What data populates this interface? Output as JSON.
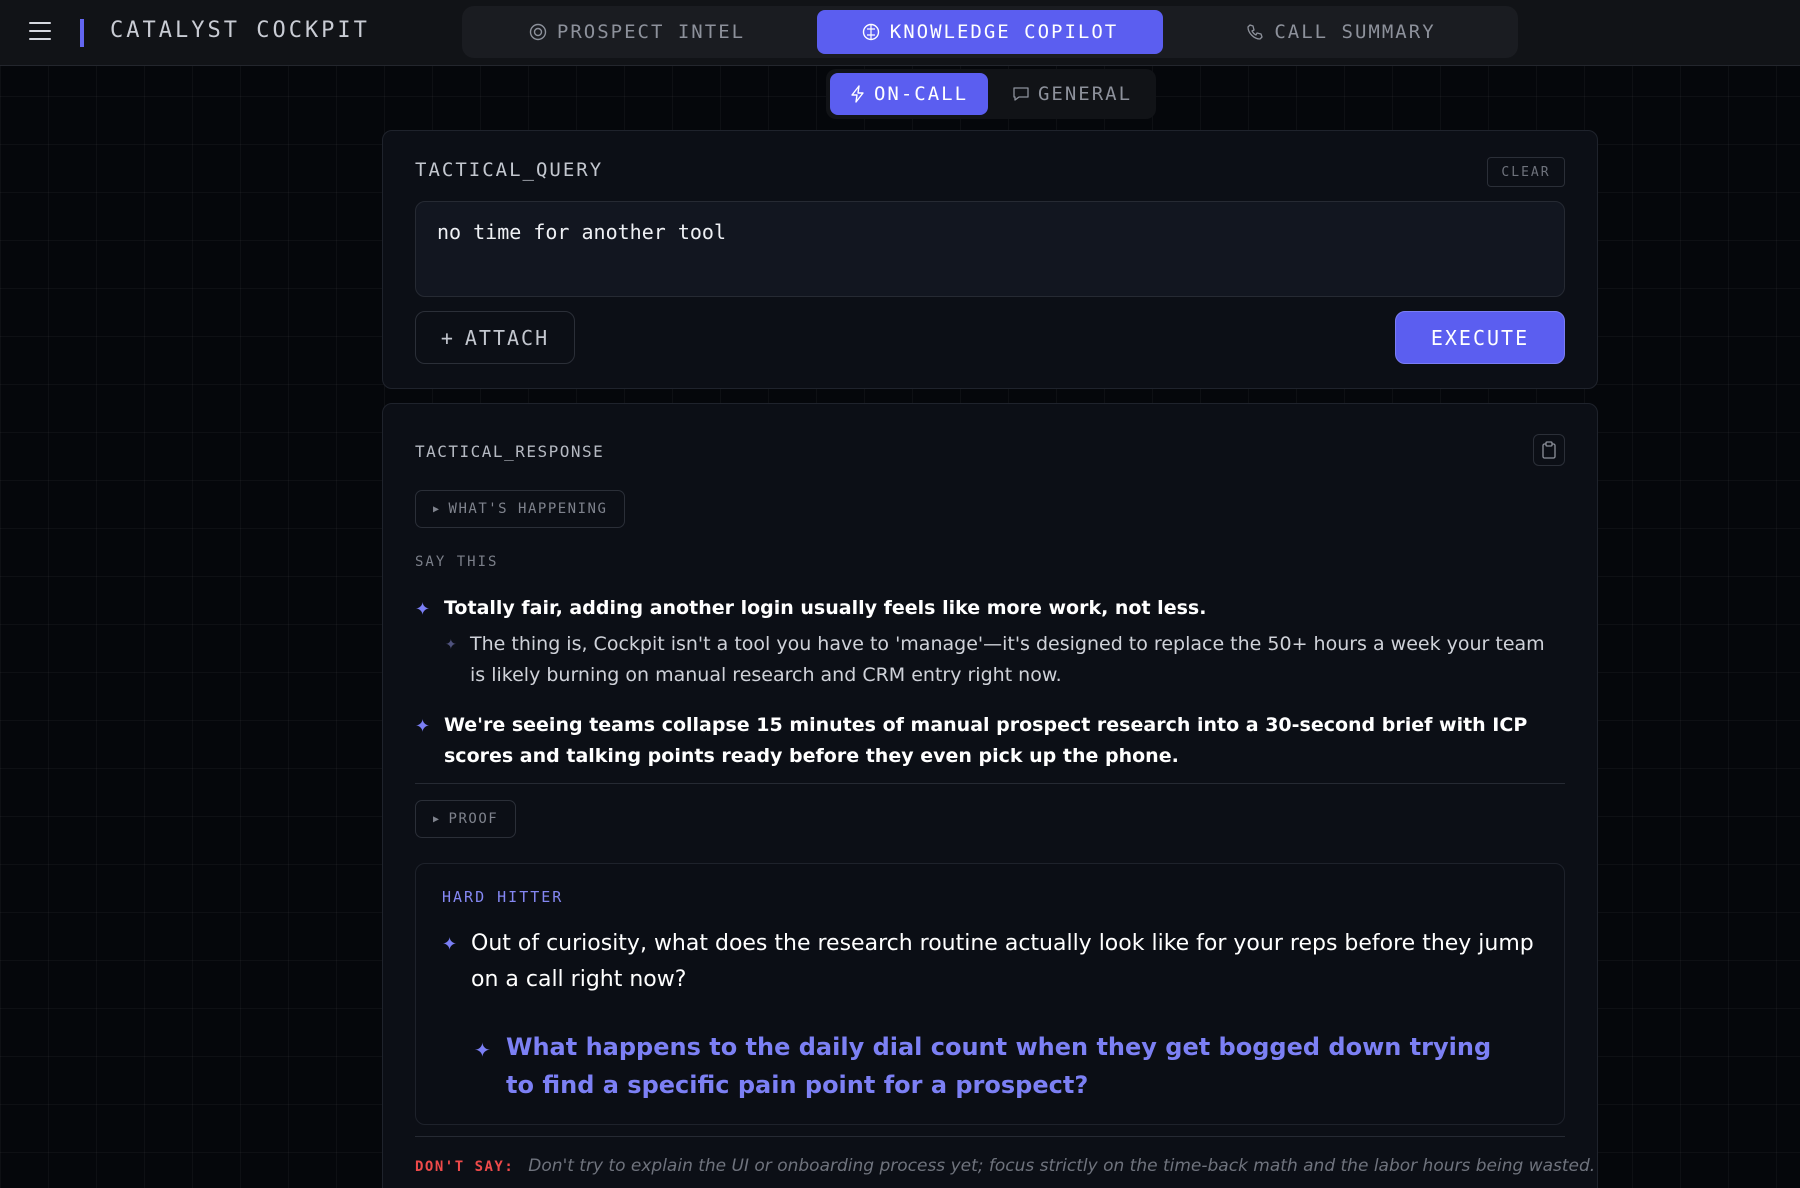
{
  "app": {
    "title": "CATALYST COCKPIT"
  },
  "nav": {
    "tabs": [
      {
        "label": "PROSPECT INTEL",
        "icon": "target-icon"
      },
      {
        "label": "KNOWLEDGE COPILOT",
        "icon": "brain-icon",
        "active": true
      },
      {
        "label": "CALL SUMMARY",
        "icon": "phone-icon"
      }
    ]
  },
  "mode": {
    "options": [
      {
        "label": "ON-CALL",
        "icon": "lightning-icon",
        "active": true
      },
      {
        "label": "GENERAL",
        "icon": "chat-bubble-icon"
      }
    ]
  },
  "query": {
    "label": "TACTICAL_QUERY",
    "clear_label": "CLEAR",
    "value": "no time for another tool",
    "attach_label": "ATTACH",
    "execute_label": "EXECUTE"
  },
  "response": {
    "label": "TACTICAL_RESPONSE",
    "whats_happening_label": "WHAT'S HAPPENING",
    "say_this_label": "SAY THIS",
    "say_this": [
      "Totally fair, adding another login usually feels like more work, not less.",
      "The thing is, Cockpit isn't a tool you have to 'manage'—it's designed to replace the 50+ hours a week your team is likely burning on manual research and CRM entry right now.",
      "We're seeing teams collapse 15 minutes of manual prospect research into a 30-second brief with ICP scores and talking points ready before they even pick up the phone."
    ],
    "proof_label": "PROOF",
    "hard_hitter": {
      "label": "HARD HITTER",
      "question": "Out of curiosity, what does the research routine actually look like for your reps before they jump on a call right now?",
      "follow_up": "What happens to the daily dial count when they get bogged down trying to find a specific pain point for a prospect?"
    },
    "dont_say_label": "DON'T SAY:",
    "dont_say": "Don't try to explain the UI or onboarding process yet; focus strictly on the time-back math and the labor hours being wasted."
  },
  "colors": {
    "accent": "#5b5ef0",
    "accent_text": "#7c80f4",
    "danger": "#ef4a4a",
    "background": "#05070b"
  }
}
